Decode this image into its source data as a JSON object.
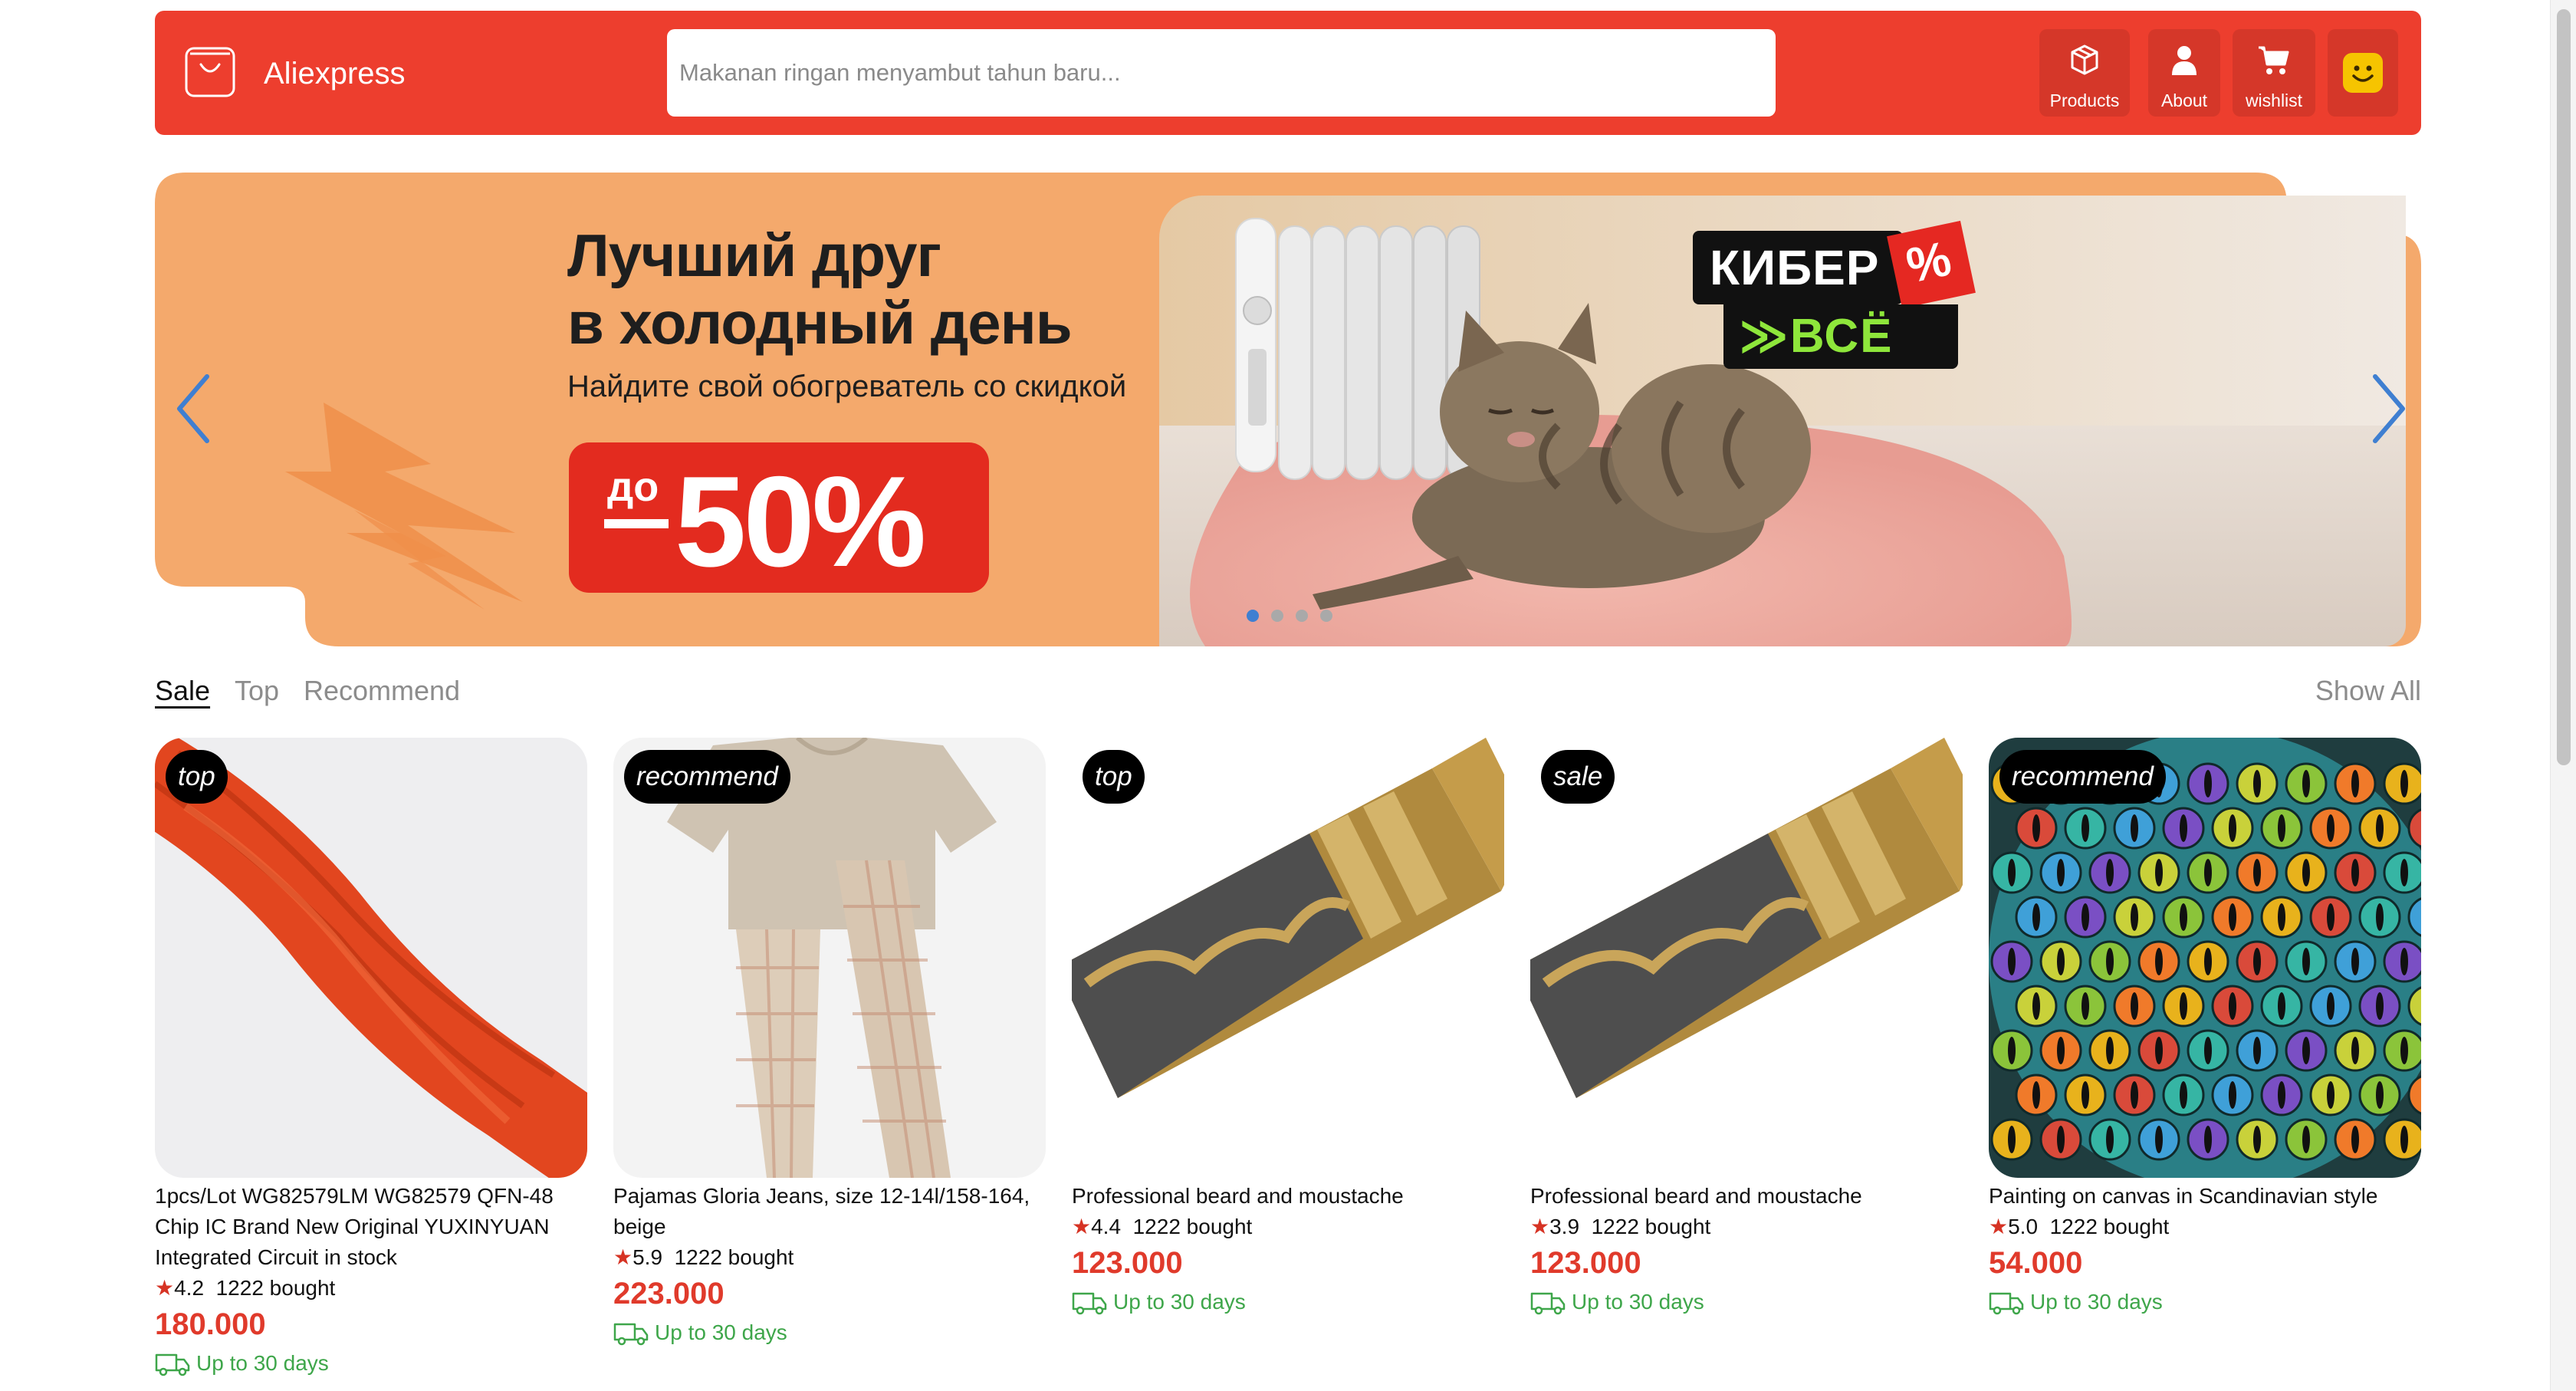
{
  "header": {
    "logo_icon": "shopping-bag-icon",
    "app_name": "Aliexpress",
    "search_placeholder": "Makanan ringan menyambut tahun baru...",
    "search_value": "",
    "buttons": [
      {
        "label": "Products",
        "icon": "box-icon"
      },
      {
        "label": "About",
        "icon": "user-icon"
      },
      {
        "label": "wishlist",
        "icon": "cart-icon"
      },
      {
        "label": "",
        "icon": "smiley-avatar-icon"
      }
    ],
    "accent": "#ed3e2e",
    "avatar_color": "#f6c400"
  },
  "banner": {
    "headline_line1": "Лучший друг",
    "headline_line2": "в холодный день",
    "subline": "Найдите свой обогреватель со скидкой",
    "discount_prefix": "до",
    "discount_value": "50%",
    "promo_badge_top": "КИБЕР",
    "promo_badge_percent": "%",
    "promo_badge_bottom": "≫ВСЁ",
    "slides_total": 4,
    "active_slide": 1,
    "bg_color": "#f4a96c",
    "arrow_color": "#3f7fd1"
  },
  "tabs": {
    "items": [
      "Sale",
      "Top",
      "Recommend"
    ],
    "active": "Sale",
    "show_all": "Show All"
  },
  "products": [
    {
      "badge": "top",
      "title": "1pcs/Lot WG82579LM WG82579 QFN-48 Chip IC Brand New Original YUXINYUAN Integrated Circuit in stock",
      "rating": "4.2",
      "bought": "1222 bought",
      "price": "180.000",
      "shipping": "Up to 30 days"
    },
    {
      "badge": "recommend",
      "title": "Pajamas Gloria Jeans, size 12-14l/158-164, beige",
      "rating": "5.9",
      "bought": "1222 bought",
      "price": "223.000",
      "shipping": "Up to 30 days"
    },
    {
      "badge": "top",
      "title": "Professional beard and moustache",
      "rating": "4.4",
      "bought": "1222 bought",
      "price": "123.000",
      "shipping": "Up to 30 days"
    },
    {
      "badge": "sale",
      "title": "Professional beard and moustache",
      "rating": "3.9",
      "bought": "1222 bought",
      "price": "123.000",
      "shipping": "Up to 30 days"
    },
    {
      "badge": "recommend",
      "title": "Painting on canvas in Scandinavian style",
      "rating": "5.0",
      "bought": "1222 bought",
      "price": "54.000",
      "shipping": "Up to 30 days"
    }
  ],
  "icons": {
    "rating": "star-icon",
    "shipping": "truck-icon",
    "banner_prev": "chevron-left-icon",
    "banner_next": "chevron-right-icon"
  },
  "colors": {
    "price": "#e03a2b",
    "shipping": "#3ea64a",
    "star": "#d63324"
  }
}
